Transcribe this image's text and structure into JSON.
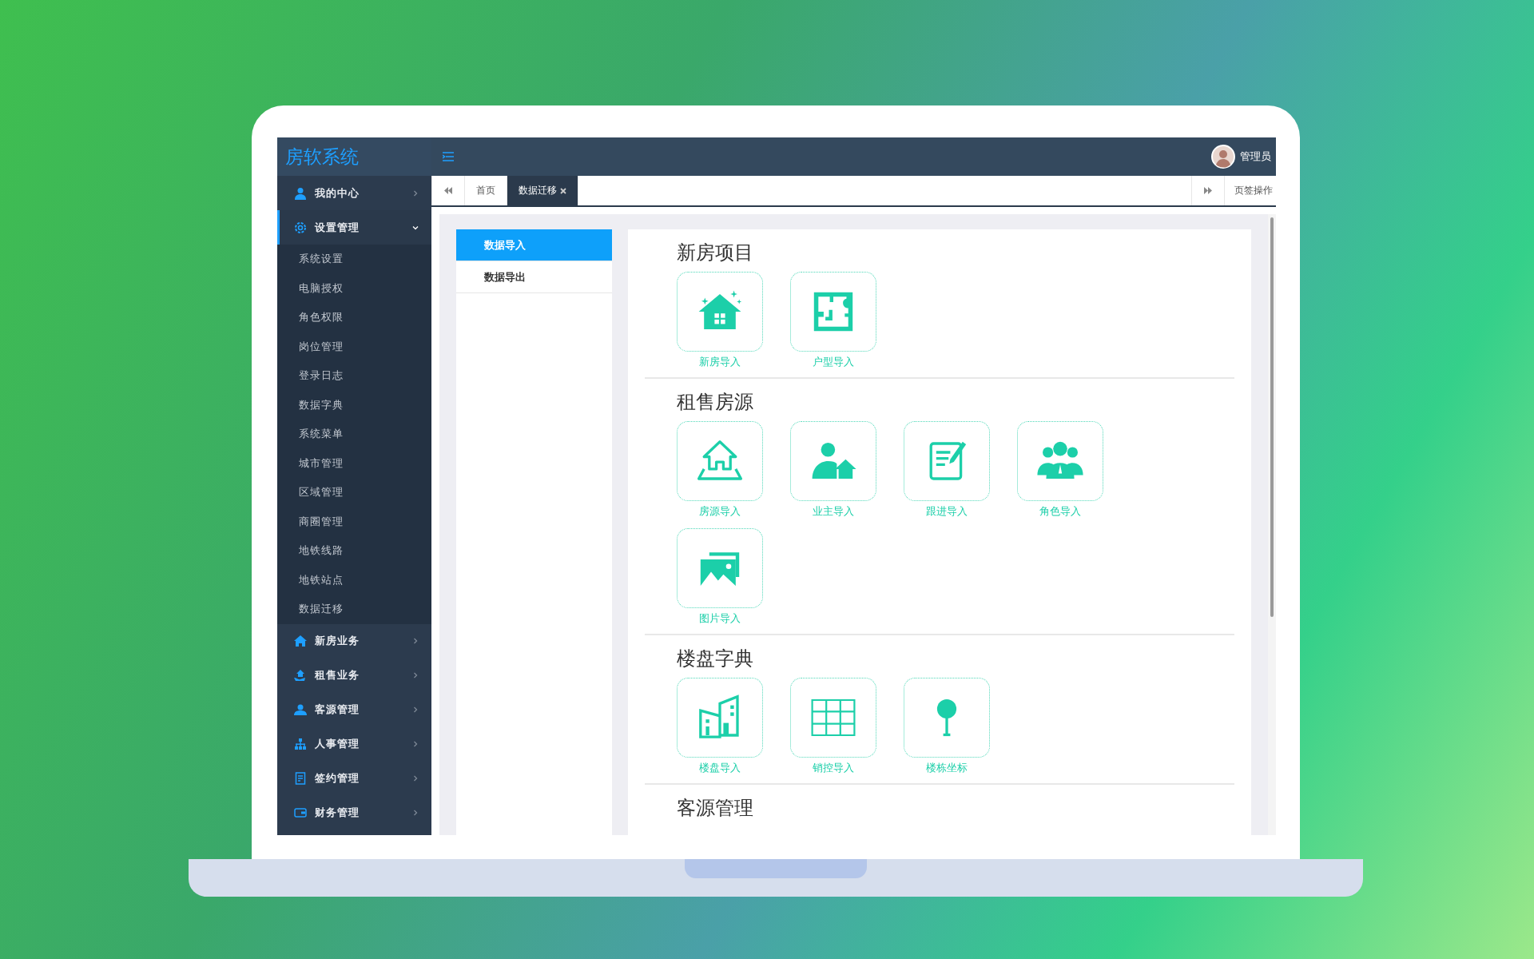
{
  "app": {
    "title": "房软系统",
    "user": "管理员"
  },
  "sidebar": [
    {
      "label": "我的中心",
      "kind": "user",
      "expanded": false
    },
    {
      "label": "设置管理",
      "kind": "gear",
      "expanded": true,
      "children": [
        {
          "label": "系统设置"
        },
        {
          "label": "电脑授权"
        },
        {
          "label": "角色权限"
        },
        {
          "label": "岗位管理"
        },
        {
          "label": "登录日志"
        },
        {
          "label": "数据字典"
        },
        {
          "label": "系统菜单"
        },
        {
          "label": "城市管理"
        },
        {
          "label": "区域管理"
        },
        {
          "label": "商圈管理"
        },
        {
          "label": "地铁线路"
        },
        {
          "label": "地铁站点"
        },
        {
          "label": "数据迁移"
        }
      ]
    },
    {
      "label": "新房业务",
      "kind": "house",
      "expanded": false
    },
    {
      "label": "租售业务",
      "kind": "hand-house",
      "expanded": false
    },
    {
      "label": "客源管理",
      "kind": "people",
      "expanded": false
    },
    {
      "label": "人事管理",
      "kind": "org",
      "expanded": false
    },
    {
      "label": "签约管理",
      "kind": "contract",
      "expanded": false
    },
    {
      "label": "财务管理",
      "kind": "wallet",
      "expanded": false
    }
  ],
  "tabs": [
    {
      "label": "首页",
      "selected": false,
      "closable": false
    },
    {
      "label": "数据迁移",
      "selected": true,
      "closable": true
    }
  ],
  "tab_actions": "页签操作",
  "subnav": [
    {
      "label": "数据导入",
      "selected": true
    },
    {
      "label": "数据导出",
      "selected": false
    }
  ],
  "sections": [
    {
      "title": "新房项目",
      "items": [
        {
          "label": "新房导入",
          "kind": "new-house"
        },
        {
          "label": "户型导入",
          "kind": "floor-plan"
        }
      ]
    },
    {
      "title": "租售房源",
      "items": [
        {
          "label": "房源导入",
          "kind": "house-outline"
        },
        {
          "label": "业主导入",
          "kind": "owner"
        },
        {
          "label": "跟进导入",
          "kind": "notes"
        },
        {
          "label": "角色导入",
          "kind": "roles"
        },
        {
          "label": "图片导入",
          "kind": "images"
        }
      ]
    },
    {
      "title": "楼盘字典",
      "items": [
        {
          "label": "楼盘导入",
          "kind": "buildings"
        },
        {
          "label": "销控导入",
          "kind": "grid"
        },
        {
          "label": "楼栋坐标",
          "kind": "pin"
        }
      ]
    },
    {
      "title": "客源管理"
    }
  ]
}
